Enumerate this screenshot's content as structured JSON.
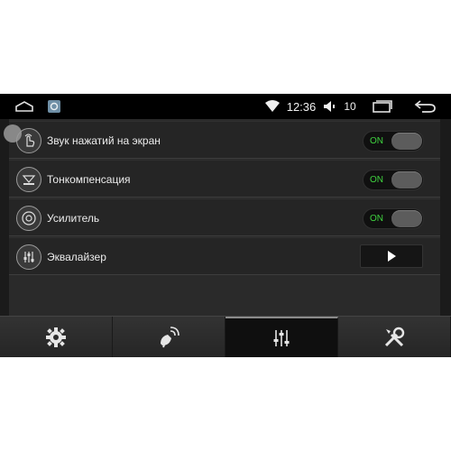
{
  "status_bar": {
    "time": "12:36",
    "volume_level": "10"
  },
  "settings": {
    "items": [
      {
        "label": "Звук нажатий на экран",
        "control": "toggle",
        "toggle_state": "ON"
      },
      {
        "label": "Тонкомпенсация",
        "control": "toggle",
        "toggle_state": "ON"
      },
      {
        "label": "Усилитель",
        "control": "toggle",
        "toggle_state": "ON"
      },
      {
        "label": "Эквалайзер",
        "control": "play"
      }
    ]
  },
  "tabs": [
    {
      "icon": "gear-icon",
      "active": false
    },
    {
      "icon": "satellite-icon",
      "active": false
    },
    {
      "icon": "sliders-icon",
      "active": true
    },
    {
      "icon": "tools-icon",
      "active": false
    }
  ],
  "colors": {
    "toggle_on_text": "#3fd33f",
    "background": "#1b1b1b"
  }
}
